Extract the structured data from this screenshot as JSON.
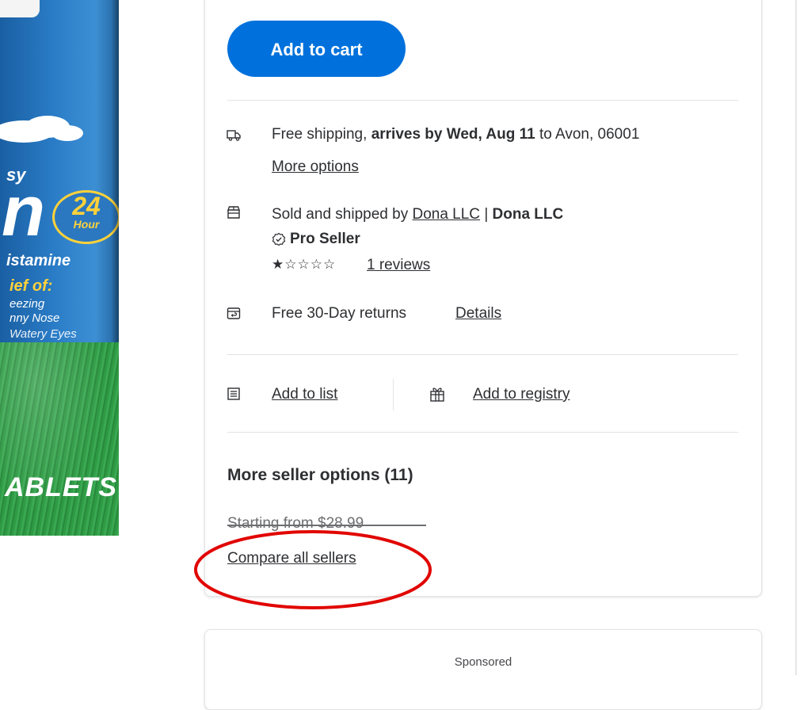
{
  "product_image": {
    "brand_tail": "sy",
    "name_tail": "n",
    "badge_number": "24",
    "badge_unit": "Hour",
    "antihistamine": "istamine",
    "relief_of": "ief of:",
    "symptom_1": "eezing",
    "symptom_2": "nny Nose",
    "symptom_3": "Watery Eyes",
    "tablets": "ABLETS"
  },
  "buy_box": {
    "add_to_cart_label": "Add to cart",
    "shipping": {
      "prefix": "Free shipping,",
      "arrival_bold": "arrives by Wed, Aug 11",
      "suffix": "to Avon, 06001",
      "more_options": "More options"
    },
    "seller": {
      "sold_by_prefix": "Sold and shipped by",
      "seller_link": "Dona LLC",
      "separator": "|",
      "seller_bold": "Dona LLC",
      "pro_seller": "Pro Seller",
      "rating_stars": "★☆☆☆☆",
      "rating": 1,
      "rating_max": 5,
      "reviews_link": "1 reviews"
    },
    "returns": {
      "text": "Free 30-Day returns",
      "details_link": "Details"
    },
    "actions": {
      "add_to_list": "Add to list",
      "add_to_registry": "Add to registry"
    },
    "more_sellers": {
      "title": "More seller options (11)",
      "starting_from": "Starting from $28.99",
      "compare_link": "Compare all sellers"
    }
  },
  "sponsored": {
    "label": "Sponsored"
  },
  "colors": {
    "primary_button": "#0071dc",
    "text": "#2e2f32",
    "annotation": "#e10600",
    "divider": "#e3e4e5"
  },
  "icons": [
    "truck-icon",
    "store-icon",
    "check-badge-icon",
    "return-box-icon",
    "list-icon",
    "gift-icon"
  ]
}
